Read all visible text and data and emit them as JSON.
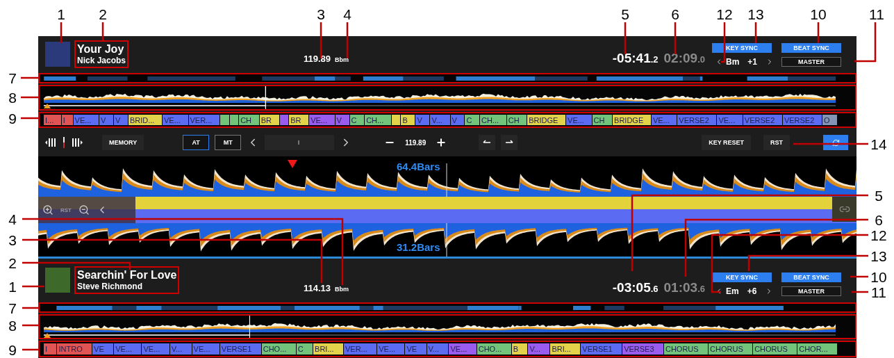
{
  "decks": [
    {
      "title": "Your Joy",
      "artist": "Nick Jacobs",
      "bpm": "119.89",
      "key": "Bbm",
      "time_remaining": "-05:41",
      "time_remaining_tenths": ".2",
      "time_elapsed": "02:09",
      "time_elapsed_tenths": ".0",
      "key_sync": {
        "label": "KEY SYNC",
        "on": true
      },
      "beat_sync": {
        "label": "BEAT SYNC",
        "on": true
      },
      "master": {
        "label": "MASTER",
        "on": false
      },
      "current_key": "Bm",
      "key_shift": "+1",
      "playhead": {
        "level": 0.28
      },
      "phrases": [
        {
          "label": "I...",
          "color": "#e05454"
        },
        {
          "label": "I",
          "color": "#e05454"
        },
        {
          "label": "VE...",
          "color": "#5b6cf2"
        },
        {
          "label": "V",
          "color": "#5b6cf2"
        },
        {
          "label": "V",
          "color": "#5b6cf2"
        },
        {
          "label": "BRID...",
          "color": "#e2d34a"
        },
        {
          "label": "VE...",
          "color": "#5b6cf2"
        },
        {
          "label": "VER...",
          "color": "#5b6cf2"
        },
        {
          "color": "#72c47a"
        },
        {
          "color": "#72c47a"
        },
        {
          "label": "CH",
          "color": "#72c47a"
        },
        {
          "label": "BR",
          "color": "#e2d34a"
        },
        {
          "color": "#9a5cee"
        },
        {
          "label": "BR",
          "color": "#e2d34a"
        },
        {
          "label": "VE...",
          "color": "#9a5cee"
        },
        {
          "label": "V",
          "color": "#9a5cee"
        },
        {
          "label": "C",
          "color": "#72c47a"
        },
        {
          "label": "CH...",
          "color": "#72c47a"
        },
        {
          "color": "#e2d34a"
        },
        {
          "label": "B",
          "color": "#e2d34a"
        },
        {
          "label": "V",
          "color": "#5b6cf2"
        },
        {
          "label": "V...",
          "color": "#5b6cf2"
        },
        {
          "label": "V",
          "color": "#5b6cf2"
        },
        {
          "label": "C",
          "color": "#72c47a"
        },
        {
          "label": "CH...",
          "color": "#72c47a"
        },
        {
          "label": "CH",
          "color": "#72c47a"
        },
        {
          "label": "BRIDGE",
          "color": "#e2d34a"
        },
        {
          "label": "VE...",
          "color": "#5b6cf2"
        },
        {
          "label": "CH",
          "color": "#72c47a"
        },
        {
          "label": "BRIDGE",
          "color": "#e2d34a"
        },
        {
          "label": "VE...",
          "color": "#5b6cf2"
        },
        {
          "label": "VERSE2",
          "color": "#5b6cf2"
        },
        {
          "label": "VE...",
          "color": "#5b6cf2"
        },
        {
          "label": "VERSE2",
          "color": "#5b6cf2"
        },
        {
          "label": "VERSE2",
          "color": "#5b6cf2"
        },
        {
          "label": "O",
          "color": "#8494b4"
        }
      ]
    },
    {
      "title": "Searchin' For Love",
      "artist": "Steve Richmond",
      "bpm": "114.13",
      "key": "Bbm",
      "time_remaining": "-03:05",
      "time_remaining_tenths": ".6",
      "time_elapsed": "01:03",
      "time_elapsed_tenths": ".6",
      "key_sync": {
        "label": "KEY SYNC",
        "on": true
      },
      "beat_sync": {
        "label": "BEAT SYNC",
        "on": true
      },
      "master": {
        "label": "MASTER",
        "on": false
      },
      "current_key": "Em",
      "key_shift": "+6",
      "playhead": {
        "level": 0.26
      },
      "phrases": [
        {
          "label": "I",
          "color": "#e05454"
        },
        {
          "label": "INTRO",
          "color": "#e05454"
        },
        {
          "label": "VE",
          "color": "#5b6cf2"
        },
        {
          "label": "VE...",
          "color": "#5b6cf2"
        },
        {
          "label": "VE...",
          "color": "#5b6cf2"
        },
        {
          "label": "V...",
          "color": "#5b6cf2"
        },
        {
          "label": "VE...",
          "color": "#5b6cf2"
        },
        {
          "label": "VERSE1",
          "color": "#5b6cf2"
        },
        {
          "label": "CHO...",
          "color": "#72c47a"
        },
        {
          "label": "C",
          "color": "#72c47a"
        },
        {
          "label": "BRI...",
          "color": "#e2d34a"
        },
        {
          "label": "VER...",
          "color": "#5b6cf2"
        },
        {
          "label": "VE...",
          "color": "#5b6cf2"
        },
        {
          "label": "VE",
          "color": "#5b6cf2"
        },
        {
          "label": "V...",
          "color": "#5b6cf2"
        },
        {
          "label": "VE...",
          "color": "#9a5cee"
        },
        {
          "label": "CHO...",
          "color": "#72c47a"
        },
        {
          "label": "B",
          "color": "#e2d34a"
        },
        {
          "label": "V...",
          "color": "#9a5cee"
        },
        {
          "label": "BRI...",
          "color": "#e2d34a"
        },
        {
          "label": "VERSE1",
          "color": "#5b6cf2"
        },
        {
          "label": "VERSE3",
          "color": "#9a5cee"
        },
        {
          "label": "CHORUS",
          "color": "#72c47a"
        },
        {
          "label": "CHORUS",
          "color": "#72c47a"
        },
        {
          "label": "CHORUS",
          "color": "#72c47a"
        },
        {
          "label": "CHOR...",
          "color": "#72c47a"
        }
      ]
    }
  ],
  "controls": {
    "memory": "MEMORY",
    "modes": [
      {
        "label": "AT",
        "selected": true
      },
      {
        "label": "MT",
        "selected": false
      }
    ],
    "bpm": "119.89",
    "key_reset": "KEY RESET",
    "rst": "RST"
  },
  "zoom": {
    "top_label": "64.4Bars",
    "bottom_label": "31.2Bars",
    "rst": "RST"
  },
  "callouts": [
    {
      "number": "1"
    },
    {
      "number": "2"
    },
    {
      "number": "3"
    },
    {
      "number": "4"
    },
    {
      "number": "5"
    },
    {
      "number": "6"
    },
    {
      "number": "12"
    },
    {
      "number": "13"
    },
    {
      "number": "10"
    },
    {
      "number": "11"
    },
    {
      "number": "7"
    },
    {
      "number": "8"
    },
    {
      "number": "9"
    },
    {
      "number": "14"
    },
    {
      "number": "5"
    },
    {
      "number": "4"
    },
    {
      "number": "6"
    },
    {
      "number": "3"
    },
    {
      "number": "12"
    },
    {
      "number": "2"
    },
    {
      "number": "13"
    },
    {
      "number": "1"
    },
    {
      "number": "10"
    },
    {
      "number": "11"
    },
    {
      "number": "7"
    },
    {
      "number": "8"
    },
    {
      "number": "9"
    }
  ]
}
